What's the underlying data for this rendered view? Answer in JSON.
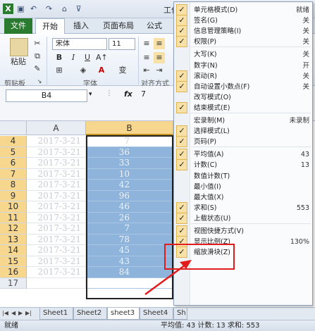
{
  "title_bar": {
    "app_title": "工作"
  },
  "tabs": [
    "文件",
    "开始",
    "插入",
    "页面布局",
    "公式"
  ],
  "ribbon": {
    "paste_label": "粘贴",
    "font_name": "宋体",
    "font_size": "11",
    "bold": "B",
    "italic": "I",
    "underline": "U",
    "font_color_glyph": "A",
    "wen_glyph": "变",
    "groups": [
      "剪贴板",
      "字体",
      "对齐方式"
    ]
  },
  "formula_bar": {
    "name_box": "B4",
    "fx": "fx",
    "value": "7"
  },
  "grid": {
    "col_headers": [
      "A",
      "B"
    ],
    "rows": [
      {
        "num": "4",
        "a": "2017-3-21",
        "b": "7"
      },
      {
        "num": "5",
        "a": "2017-3-21",
        "b": "36"
      },
      {
        "num": "6",
        "a": "2017-3-21",
        "b": "33"
      },
      {
        "num": "7",
        "a": "2017-3-21",
        "b": "10"
      },
      {
        "num": "8",
        "a": "2017-3-21",
        "b": "42"
      },
      {
        "num": "9",
        "a": "2017-3-21",
        "b": "96"
      },
      {
        "num": "10",
        "a": "2017-3-21",
        "b": "46"
      },
      {
        "num": "11",
        "a": "2017-3-21",
        "b": "26"
      },
      {
        "num": "12",
        "a": "2017-3-21",
        "b": "7"
      },
      {
        "num": "13",
        "a": "2017-3-21",
        "b": "78"
      },
      {
        "num": "14",
        "a": "2017-3-21",
        "b": "45"
      },
      {
        "num": "15",
        "a": "2017-3-21",
        "b": "43"
      },
      {
        "num": "16",
        "a": "2017-3-21",
        "b": "84"
      },
      {
        "num": "17",
        "a": "",
        "b": ""
      }
    ]
  },
  "sheets": [
    "Sheet1",
    "Sheet2",
    "sheet3",
    "Sheet4",
    "Sh"
  ],
  "status_bar": {
    "ready": "就绪",
    "summary": "平均值: 43    计数: 13    求和: 553"
  },
  "context_menu": [
    {
      "label": "单元格模式(D)",
      "value": "就绪",
      "checked": true
    },
    {
      "label": "签名(G)",
      "value": "关",
      "checked": true
    },
    {
      "label": "信息管理策略(I)",
      "value": "关",
      "checked": true
    },
    {
      "label": "权限(P)",
      "value": "关",
      "checked": true
    },
    {
      "sep": true
    },
    {
      "label": "大写(K)",
      "value": "关",
      "checked": false
    },
    {
      "label": "数字(N)",
      "value": "开",
      "checked": false
    },
    {
      "label": "滚动(R)",
      "value": "关",
      "checked": true
    },
    {
      "label": "自动设置小数点(F)",
      "value": "关",
      "checked": true
    },
    {
      "label": "改写模式(O)",
      "value": "",
      "checked": false
    },
    {
      "label": "结束模式(E)",
      "value": "",
      "checked": true
    },
    {
      "sep": true
    },
    {
      "label": "宏录制(M)",
      "value": "未录制",
      "checked": false
    },
    {
      "label": "选择模式(L)",
      "value": "",
      "checked": true
    },
    {
      "label": "页码(P)",
      "value": "",
      "checked": true
    },
    {
      "sep": true
    },
    {
      "label": "平均值(A)",
      "value": "43",
      "checked": true
    },
    {
      "label": "计数(C)",
      "value": "13",
      "checked": true
    },
    {
      "label": "数值计数(T)",
      "value": "",
      "checked": false
    },
    {
      "label": "最小值(I)",
      "value": "",
      "checked": false
    },
    {
      "label": "最大值(X)",
      "value": "",
      "checked": false
    },
    {
      "label": "求和(S)",
      "value": "553",
      "checked": true
    },
    {
      "label": "上载状态(U)",
      "value": "",
      "checked": true
    },
    {
      "sep": true
    },
    {
      "label": "视图快捷方式(V)",
      "value": "",
      "checked": true
    },
    {
      "label": "显示比例(Z)",
      "value": "130%",
      "checked": true
    },
    {
      "label": "缩放滑块(Z)",
      "value": "",
      "checked": true
    }
  ],
  "colors": {
    "highlight": "#e21c1c",
    "selection": "#8eb4dc",
    "check_bg": "#f8e1a6",
    "file_tab": "#2a7b2f"
  }
}
